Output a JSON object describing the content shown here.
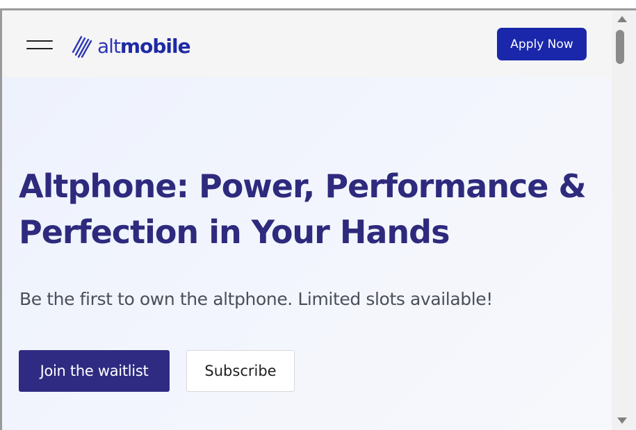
{
  "header": {
    "logo": {
      "alt": "alt",
      "mobile": "mobile",
      "color": "#1e2aa6"
    },
    "apply_label": "Apply Now",
    "apply_color": "#1a27ab",
    "menu_icon": "hamburger-icon"
  },
  "hero": {
    "title": "Altphone: Power, Performance & Perfection in Your Hands",
    "title_color": "#2e2a7d",
    "subtitle": "Be the first to own the altphone. Limited slots available!",
    "primary_cta": "Join the waitlist",
    "primary_cta_color": "#2f2b82",
    "secondary_cta": "Subscribe"
  },
  "scrollbar": {
    "up_icon": "triangle-up-icon",
    "down_icon": "triangle-down-icon"
  }
}
